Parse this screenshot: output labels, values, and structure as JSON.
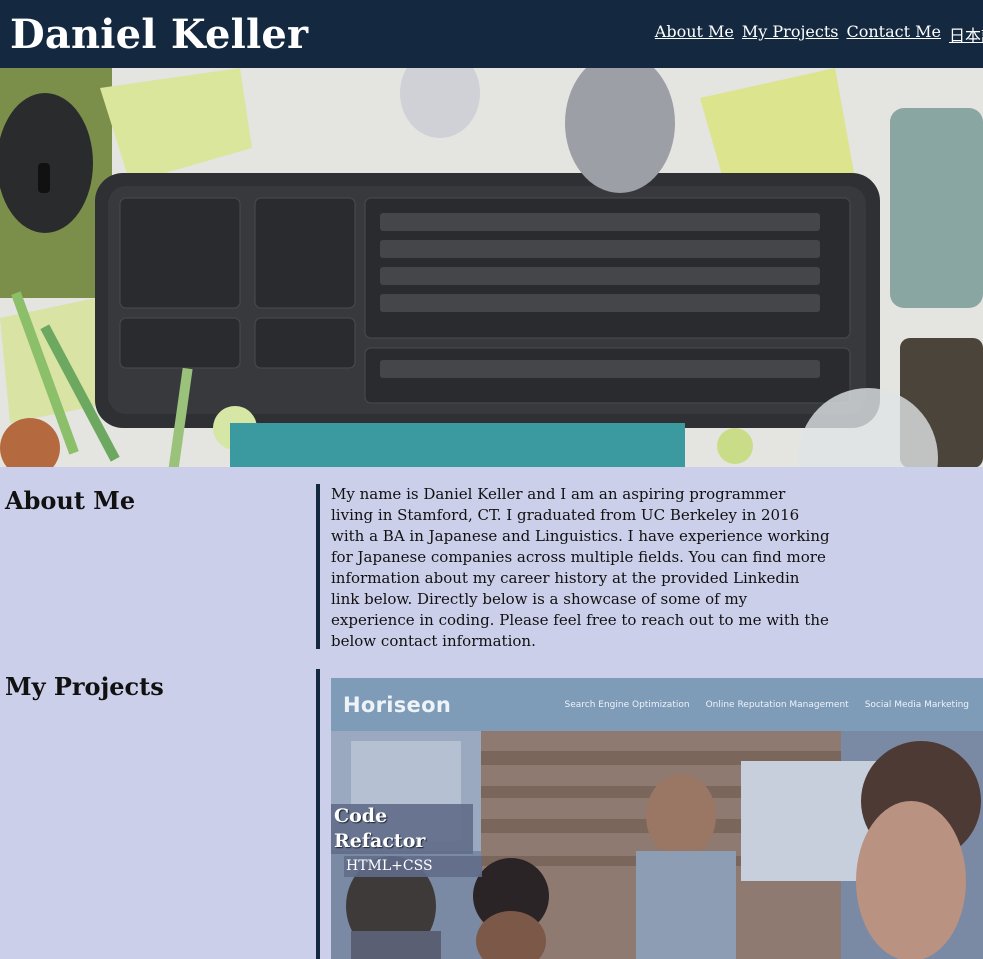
{
  "header": {
    "title": "Daniel Keller",
    "nav": [
      "About Me",
      "My Projects",
      "Contact Me",
      "日本語"
    ]
  },
  "about": {
    "heading": "About Me",
    "text": "My name is Daniel Keller and I am an aspiring programmer living in Stamford, CT. I graduated from UC Berkeley in 2016 with a BA in Japanese and Linguistics. I have experience working for Japanese companies across multiple fields. You can find more information about my career history at the provided Linkedin link below. Directly below is a showcase of some of my experience in coding. Please feel free to reach out to me with the below contact information."
  },
  "projects": {
    "heading": "My Projects",
    "items": [
      {
        "title_line1": "Code",
        "title_line2": "Refactor",
        "tag": "HTML+CSS",
        "preview": {
          "logo": "Horiseon",
          "links": [
            "Search Engine Optimization",
            "Online Reputation Management",
            "Social Media Marketing"
          ]
        }
      }
    ]
  },
  "colors": {
    "header_bg": "#14293f",
    "page_bg": "#cbcfe9",
    "divider": "#14293f"
  }
}
